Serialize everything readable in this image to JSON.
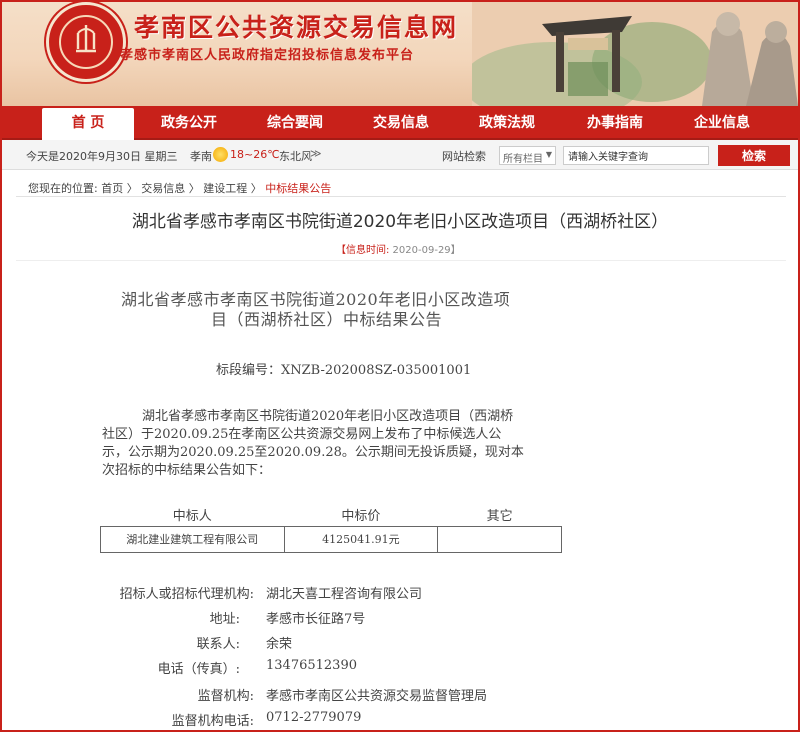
{
  "banner": {
    "title": "孝南区公共资源交易信息网",
    "subtitle": "孝感市孝南区人民政府指定招投标信息发布平台"
  },
  "nav": {
    "items": [
      "首 页",
      "政务公开",
      "综合要闻",
      "交易信息",
      "政策法规",
      "办事指南",
      "企业信息"
    ],
    "active_index": 0
  },
  "infobar": {
    "date": "今天是2020年9月30日 星期三",
    "city": "孝南",
    "temperature": "18~26℃",
    "wind": "东北风",
    "wind_more": "≫",
    "search_label": "网站检索",
    "scope_value": "所有栏目",
    "search_value": "请输入关键字查询",
    "search_button": "检索"
  },
  "breadcrumb": {
    "prefix": "您现在的位置:",
    "items": [
      "首页",
      "交易信息",
      "建设工程"
    ],
    "current": "中标结果公告",
    "separator": "〉"
  },
  "article": {
    "title": "湖北省孝感市孝南区书院街道2020年老旧小区改造项目（西湖桥社区）",
    "info_time_label": "【信息时间:",
    "info_time_value": " 2020-09-29】",
    "doc_title_line1": "湖北省孝感市孝南区书院街道2020年老旧小区改造项",
    "doc_title_line2": "目（西湖桥社区）中标结果公告",
    "bid_no": "标段编号：XNZB-202008SZ-035001001",
    "body_lines": [
      "湖北省孝感市孝南区书院街道2020年老旧小区改造项目（西湖桥",
      "社区）于2020.09.25在孝南区公共资源交易网上发布了中标候选人公",
      "示，公示期为2020.09.25至2020.09.28。公示期间无投诉质疑，现对本",
      "次招标的中标结果公告如下："
    ]
  },
  "award_table": {
    "headers": [
      "中标人",
      "中标价",
      "其它"
    ],
    "rows": [
      [
        "湖北建业建筑工程有限公司",
        "4125041.91元",
        ""
      ]
    ]
  },
  "contacts": [
    {
      "label": "招标人或招标代理机构:",
      "value": "湖北天喜工程咨询有限公司"
    },
    {
      "label": "地址:",
      "value": "孝感市长征路7号"
    },
    {
      "label": "联系人:",
      "value": "余荣"
    },
    {
      "label": "电话（传真）:",
      "value": "13476512390"
    },
    {
      "label": "监督机构:",
      "value": "孝感市孝南区公共资源交易监督管理局"
    },
    {
      "label": "监督机构电话:",
      "value": "0712-2779079"
    }
  ],
  "colors": {
    "brand_red": "#c8211a",
    "banner_bg": "#f3d6bb",
    "infobar_bg": "#f4f4f4"
  }
}
